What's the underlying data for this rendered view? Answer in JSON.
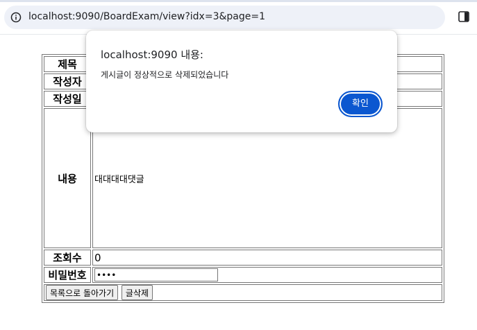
{
  "browser": {
    "url": "localhost:9090/BoardExam/view?idx=3&page=1"
  },
  "board": {
    "labels": {
      "title": "제목",
      "author": "작성자",
      "date": "작성일",
      "content": "내용",
      "views": "조회수",
      "password": "비밀번호"
    },
    "values": {
      "title": "",
      "author": "",
      "date": "",
      "content": "대대대대댓글",
      "views": "0",
      "password": "••••"
    },
    "buttons": {
      "back_to_list": "목록으로 돌아가기",
      "delete_post": "글삭제"
    }
  },
  "dialog": {
    "title": "localhost:9090 내용:",
    "message": "게시글이 정상적으로 삭제되었습니다",
    "confirm_label": "확인"
  },
  "colors": {
    "accent": "#0b57d0",
    "omnibox_bg": "#eef1f8"
  }
}
